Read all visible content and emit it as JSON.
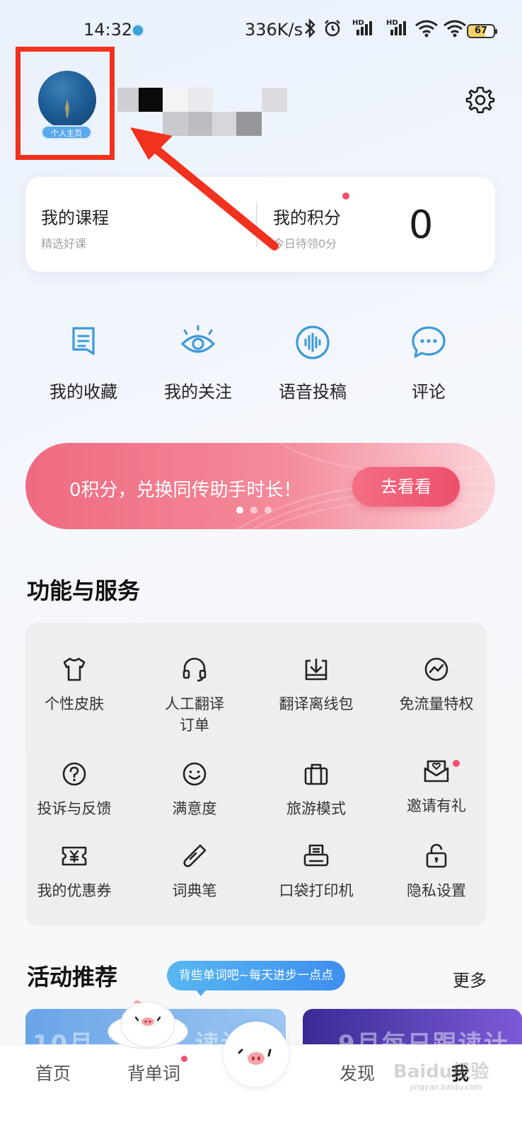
{
  "status_bar": {
    "time": "14:32",
    "speed": "336K/s",
    "battery": "67",
    "signal_label_1": "HD",
    "signal_label_2": "HD"
  },
  "profile": {
    "avatar_badge": "个人主页"
  },
  "points_card": {
    "course_title": "我的课程",
    "course_sub": "精选好课",
    "points_title": "我的积分",
    "points_sub": "今日待领0分",
    "points_value": "0"
  },
  "shortcuts": [
    {
      "label": "我的收藏",
      "icon": "bookmark-icon"
    },
    {
      "label": "我的关注",
      "icon": "eye-icon"
    },
    {
      "label": "语音投稿",
      "icon": "voice-wave-icon"
    },
    {
      "label": "评论",
      "icon": "comment-icon"
    }
  ],
  "banner": {
    "text": "0积分，兑换同传助手时长！",
    "button": "去看看"
  },
  "services": {
    "title": "功能与服务",
    "items": [
      {
        "label": "个性皮肤",
        "icon": "tshirt-icon"
      },
      {
        "label": "人工翻译订单",
        "label_line1": "人工翻译",
        "label_line2": "订单",
        "icon": "headset-icon"
      },
      {
        "label": "翻译离线包",
        "icon": "download-tray-icon"
      },
      {
        "label": "免流量特权",
        "icon": "trend-circle-icon"
      },
      {
        "label": "投诉与反馈",
        "icon": "question-circle-icon"
      },
      {
        "label": "满意度",
        "icon": "smile-icon"
      },
      {
        "label": "旅游模式",
        "icon": "suitcase-icon"
      },
      {
        "label": "邀请有礼",
        "icon": "heart-envelope-icon"
      },
      {
        "label": "我的优惠券",
        "icon": "coupon-icon"
      },
      {
        "label": "词典笔",
        "icon": "pen-icon"
      },
      {
        "label": "口袋打印机",
        "icon": "printer-icon"
      },
      {
        "label": "隐私设置",
        "icon": "lock-icon"
      }
    ]
  },
  "activities": {
    "title": "活动推荐",
    "tip": "背些单词吧~每天进步一点点",
    "more": "更多",
    "card1_text": "10月",
    "card1_text2": "读计划",
    "card2_text": "9月每日跟读计"
  },
  "tabbar": {
    "home": "首页",
    "words": "背单词",
    "discover": "发现",
    "me": "我"
  },
  "watermark": "Baidu经验",
  "watermark_url": "jingyan.baidu.com",
  "colors": {
    "accent_blue": "#3e9ad8",
    "banner_pink": "#ef6a80",
    "red_dot": "#f2506b",
    "highlight_red": "#f0321e"
  }
}
